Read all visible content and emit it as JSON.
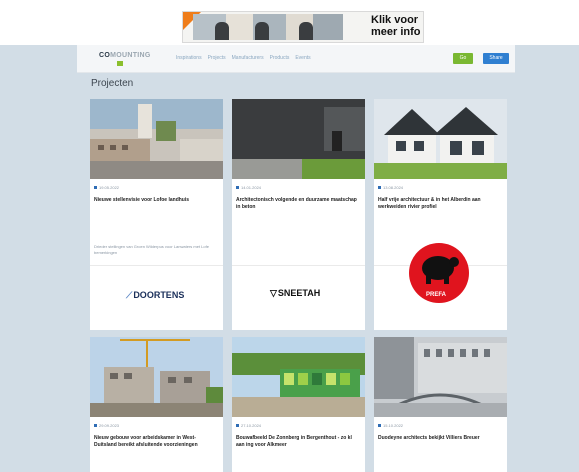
{
  "ad": {
    "line1": "Klik voor",
    "line2": "meer info"
  },
  "navbar": {
    "logo_part1": "CO",
    "logo_part2": "MOUNTING",
    "items": [
      "Inspirations",
      "Projects",
      "Manufacturers",
      "Products",
      "Events"
    ],
    "cta_green": "Go",
    "cta_blue": "Share"
  },
  "page": {
    "title": "Projecten"
  },
  "cards": [
    {
      "date": "19.05.2022",
      "headline": "Nieuwe stellenvisie voor Lofoe landhuis",
      "sponsor": "Drieder stellingen van Groen Wilderpus voor Lanwaters met Lofe bemerkingen",
      "brand": "DOORTENS"
    },
    {
      "date": "14.01.2024",
      "headline": "Architectonisch volgende en duurzame maatschap in beton",
      "sponsor": "",
      "brand": "SNEETAH"
    },
    {
      "date": "13.08.2024",
      "headline": "Half vrije architectuur & in het Alberdin aan werkweiden rivier profiel",
      "sponsor": "",
      "brand": "PREFA"
    },
    {
      "date": "29.09.2023",
      "headline": "Nieuw gebouw voor arbeidskamer in West-Duitsland bereikt afsluitende voorzieningen",
      "sponsor": "",
      "brand": ""
    },
    {
      "date": "27.10.2024",
      "headline": "Bouwafbeeld De Zonnberg in Bergenthout - zo kl aan ing voor Alkmeer",
      "sponsor": "",
      "brand": ""
    },
    {
      "date": "15.10.2022",
      "headline": "Duodeyne architects bekijkt Villiers Breuer",
      "sponsor": "",
      "brand": ""
    }
  ]
}
